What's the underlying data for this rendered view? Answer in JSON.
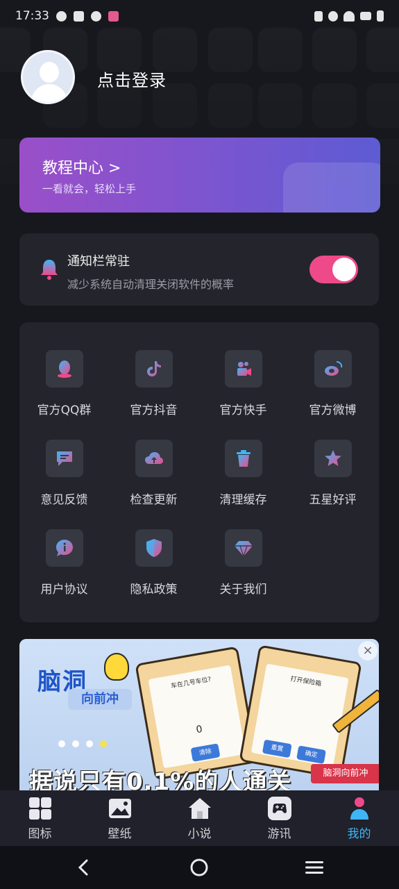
{
  "status_bar": {
    "time": "17:33"
  },
  "profile": {
    "login_label": "点击登录"
  },
  "tutorial": {
    "title": "教程中心 >",
    "subtitle": "一看就会，轻松上手"
  },
  "notification": {
    "title": "通知栏常驻",
    "subtitle": "减少系统自动清理关闭软件的概率",
    "toggle_on": true,
    "toggle_color": "#ee4a8a"
  },
  "menu": {
    "items": [
      {
        "label": "官方QQ群",
        "icon": "qq-icon"
      },
      {
        "label": "官方抖音",
        "icon": "douyin-icon"
      },
      {
        "label": "官方快手",
        "icon": "kuaishou-icon"
      },
      {
        "label": "官方微博",
        "icon": "weibo-icon"
      },
      {
        "label": "意见反馈",
        "icon": "feedback-icon"
      },
      {
        "label": "检查更新",
        "icon": "cloud-upload-icon"
      },
      {
        "label": "清理缓存",
        "icon": "trash-icon"
      },
      {
        "label": "五星好评",
        "icon": "star-icon"
      },
      {
        "label": "用户协议",
        "icon": "info-icon"
      },
      {
        "label": "隐私政策",
        "icon": "shield-icon"
      },
      {
        "label": "关于我们",
        "icon": "diamond-icon"
      }
    ]
  },
  "ad": {
    "brand": "脑洞",
    "brand_sub": "向前冲",
    "clip1_title": "车在几号车位?",
    "clip1_numbers": "0",
    "clip1_button": "清除",
    "clip2_title": "打开保险箱",
    "clip2_button_a": "重置",
    "clip2_button_b": "确定",
    "headline": "据说只有0.1%的人通关",
    "tag": "脑洞向前冲",
    "close": "×"
  },
  "tabbar": {
    "tabs": [
      {
        "label": "图标",
        "icon": "grid-icon",
        "active": false
      },
      {
        "label": "壁纸",
        "icon": "image-icon",
        "active": false
      },
      {
        "label": "小说",
        "icon": "home-icon",
        "active": false
      },
      {
        "label": "游讯",
        "icon": "gamepad-icon",
        "active": false
      },
      {
        "label": "我的",
        "icon": "person-icon",
        "active": true
      }
    ],
    "active_color": "#3fb5f5"
  }
}
